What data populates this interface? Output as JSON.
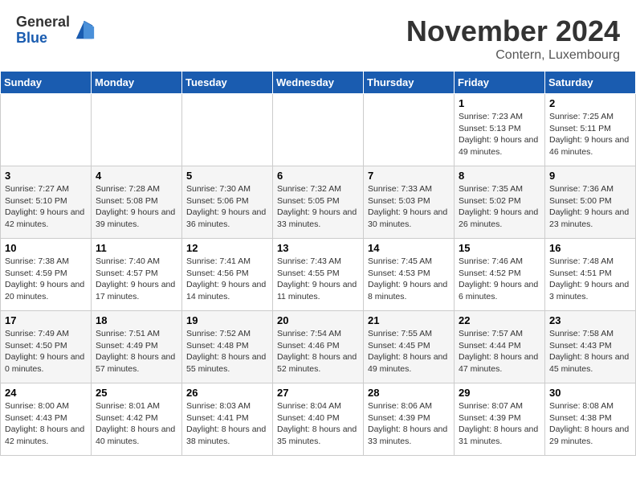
{
  "logo": {
    "general": "General",
    "blue": "Blue"
  },
  "title": "November 2024",
  "location": "Contern, Luxembourg",
  "days_of_week": [
    "Sunday",
    "Monday",
    "Tuesday",
    "Wednesday",
    "Thursday",
    "Friday",
    "Saturday"
  ],
  "weeks": [
    [
      {
        "day": "",
        "info": ""
      },
      {
        "day": "",
        "info": ""
      },
      {
        "day": "",
        "info": ""
      },
      {
        "day": "",
        "info": ""
      },
      {
        "day": "",
        "info": ""
      },
      {
        "day": "1",
        "info": "Sunrise: 7:23 AM\nSunset: 5:13 PM\nDaylight: 9 hours and 49 minutes."
      },
      {
        "day": "2",
        "info": "Sunrise: 7:25 AM\nSunset: 5:11 PM\nDaylight: 9 hours and 46 minutes."
      }
    ],
    [
      {
        "day": "3",
        "info": "Sunrise: 7:27 AM\nSunset: 5:10 PM\nDaylight: 9 hours and 42 minutes."
      },
      {
        "day": "4",
        "info": "Sunrise: 7:28 AM\nSunset: 5:08 PM\nDaylight: 9 hours and 39 minutes."
      },
      {
        "day": "5",
        "info": "Sunrise: 7:30 AM\nSunset: 5:06 PM\nDaylight: 9 hours and 36 minutes."
      },
      {
        "day": "6",
        "info": "Sunrise: 7:32 AM\nSunset: 5:05 PM\nDaylight: 9 hours and 33 minutes."
      },
      {
        "day": "7",
        "info": "Sunrise: 7:33 AM\nSunset: 5:03 PM\nDaylight: 9 hours and 30 minutes."
      },
      {
        "day": "8",
        "info": "Sunrise: 7:35 AM\nSunset: 5:02 PM\nDaylight: 9 hours and 26 minutes."
      },
      {
        "day": "9",
        "info": "Sunrise: 7:36 AM\nSunset: 5:00 PM\nDaylight: 9 hours and 23 minutes."
      }
    ],
    [
      {
        "day": "10",
        "info": "Sunrise: 7:38 AM\nSunset: 4:59 PM\nDaylight: 9 hours and 20 minutes."
      },
      {
        "day": "11",
        "info": "Sunrise: 7:40 AM\nSunset: 4:57 PM\nDaylight: 9 hours and 17 minutes."
      },
      {
        "day": "12",
        "info": "Sunrise: 7:41 AM\nSunset: 4:56 PM\nDaylight: 9 hours and 14 minutes."
      },
      {
        "day": "13",
        "info": "Sunrise: 7:43 AM\nSunset: 4:55 PM\nDaylight: 9 hours and 11 minutes."
      },
      {
        "day": "14",
        "info": "Sunrise: 7:45 AM\nSunset: 4:53 PM\nDaylight: 9 hours and 8 minutes."
      },
      {
        "day": "15",
        "info": "Sunrise: 7:46 AM\nSunset: 4:52 PM\nDaylight: 9 hours and 6 minutes."
      },
      {
        "day": "16",
        "info": "Sunrise: 7:48 AM\nSunset: 4:51 PM\nDaylight: 9 hours and 3 minutes."
      }
    ],
    [
      {
        "day": "17",
        "info": "Sunrise: 7:49 AM\nSunset: 4:50 PM\nDaylight: 9 hours and 0 minutes."
      },
      {
        "day": "18",
        "info": "Sunrise: 7:51 AM\nSunset: 4:49 PM\nDaylight: 8 hours and 57 minutes."
      },
      {
        "day": "19",
        "info": "Sunrise: 7:52 AM\nSunset: 4:48 PM\nDaylight: 8 hours and 55 minutes."
      },
      {
        "day": "20",
        "info": "Sunrise: 7:54 AM\nSunset: 4:46 PM\nDaylight: 8 hours and 52 minutes."
      },
      {
        "day": "21",
        "info": "Sunrise: 7:55 AM\nSunset: 4:45 PM\nDaylight: 8 hours and 49 minutes."
      },
      {
        "day": "22",
        "info": "Sunrise: 7:57 AM\nSunset: 4:44 PM\nDaylight: 8 hours and 47 minutes."
      },
      {
        "day": "23",
        "info": "Sunrise: 7:58 AM\nSunset: 4:43 PM\nDaylight: 8 hours and 45 minutes."
      }
    ],
    [
      {
        "day": "24",
        "info": "Sunrise: 8:00 AM\nSunset: 4:43 PM\nDaylight: 8 hours and 42 minutes."
      },
      {
        "day": "25",
        "info": "Sunrise: 8:01 AM\nSunset: 4:42 PM\nDaylight: 8 hours and 40 minutes."
      },
      {
        "day": "26",
        "info": "Sunrise: 8:03 AM\nSunset: 4:41 PM\nDaylight: 8 hours and 38 minutes."
      },
      {
        "day": "27",
        "info": "Sunrise: 8:04 AM\nSunset: 4:40 PM\nDaylight: 8 hours and 35 minutes."
      },
      {
        "day": "28",
        "info": "Sunrise: 8:06 AM\nSunset: 4:39 PM\nDaylight: 8 hours and 33 minutes."
      },
      {
        "day": "29",
        "info": "Sunrise: 8:07 AM\nSunset: 4:39 PM\nDaylight: 8 hours and 31 minutes."
      },
      {
        "day": "30",
        "info": "Sunrise: 8:08 AM\nSunset: 4:38 PM\nDaylight: 8 hours and 29 minutes."
      }
    ]
  ]
}
